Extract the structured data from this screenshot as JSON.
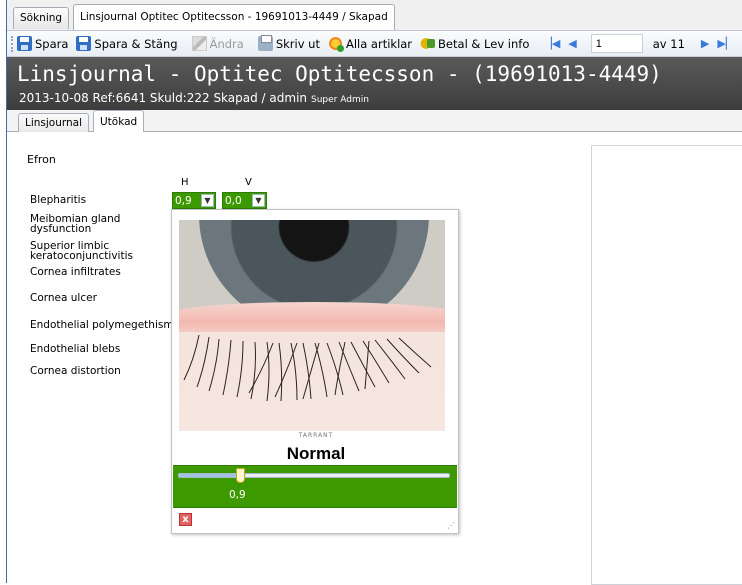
{
  "top_tabs": [
    {
      "label": "Sökning"
    },
    {
      "label": "Linsjournal Optitec Optitecsson - 19691013-4449 / Skapad"
    }
  ],
  "toolbar": {
    "save_label": "Spara",
    "save_close_label": "Spara & Stäng",
    "edit_label": "Ändra",
    "print_label": "Skriv ut",
    "articles_label": "Alla artiklar",
    "pay_label": "Betal & Lev info",
    "page_value": "1",
    "page_of": "av 11"
  },
  "header": {
    "title": "Linsjournal - Optitec Optitecsson - (19691013-4449)",
    "subtitle": "2013-10-08 Ref:6641 Skuld:222 Skapad / admin",
    "role": "Super Admin"
  },
  "inner_tabs": [
    {
      "label": "Linsjournal"
    },
    {
      "label": "Utökad"
    }
  ],
  "form": {
    "section_label": "Efron",
    "col_h": "H",
    "col_v": "V",
    "value_h": "0,9",
    "value_v": "0,0",
    "conditions": [
      "Blepharitis",
      "Meibomian gland",
      "dysfunction",
      "Superior limbic",
      "keratoconjunctivitis",
      "Cornea infiltrates",
      "Cornea ulcer",
      "Endothelial polymegethism",
      "Endothelial blebs",
      "Cornea distortion"
    ]
  },
  "popup": {
    "grade_label": "Normal",
    "slider_value": "0,9",
    "slider_fraction": 0.225,
    "close_label": "x",
    "caption": "TARRANT"
  },
  "colors": {
    "accent_green": "#3c9a00",
    "header_bg": "#4a4a4a"
  }
}
